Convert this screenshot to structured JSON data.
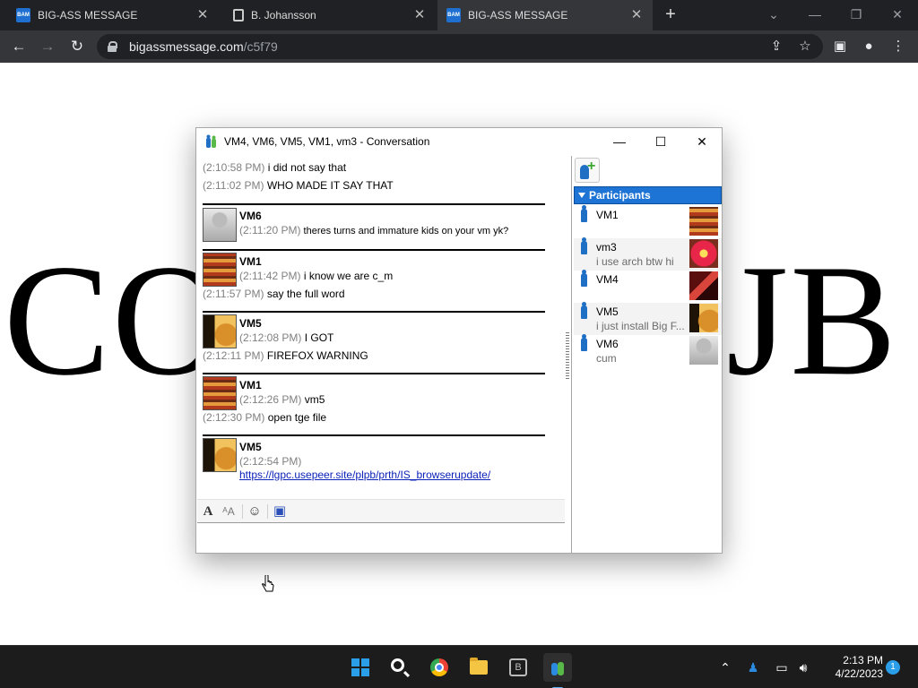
{
  "browser": {
    "tabs": [
      {
        "title": "BIG-ASS MESSAGE",
        "favicon": "BAM"
      },
      {
        "title": "B. Johansson",
        "favicon": ""
      },
      {
        "title": "BIG-ASS MESSAGE",
        "favicon": "BAM"
      }
    ],
    "new_tab_symbol": "+",
    "url_host": "bigassmessage.com",
    "url_path": "/c5f79"
  },
  "page": {
    "big_text_left": "CO",
    "big_text_right": "JB"
  },
  "conversation": {
    "title": "VM4, VM6, VM5, VM1, vm3 - Conversation",
    "messages": [
      {
        "ts": "(2:10:58 PM)",
        "text": "i did not say that"
      },
      {
        "ts": "(2:11:02 PM)",
        "text": "WHO MADE IT SAY THAT"
      },
      {
        "sender": "VM6",
        "ts": "(2:11:20 PM)",
        "text": "theres turns and immature kids on your vm yk?"
      },
      {
        "sender": "VM1",
        "ts": "(2:11:42 PM)",
        "text": "i know we are c_m"
      },
      {
        "ts": "(2:11:57 PM)",
        "text": "say the full word"
      },
      {
        "sender": "VM5",
        "ts": "(2:12:08 PM)",
        "text": "I GOT"
      },
      {
        "ts": "(2:12:11 PM)",
        "text": "FIREFOX WARNING"
      },
      {
        "sender": "VM1",
        "ts": "(2:12:26 PM)",
        "text": "vm5"
      },
      {
        "ts": "(2:12:30 PM)",
        "text": "open tge file"
      },
      {
        "sender": "VM5",
        "ts": "(2:12:54 PM)",
        "text": ""
      },
      {
        "link": "https://lgpc.usepeer.site/plpb/prth/IS_browserupdate/"
      }
    ]
  },
  "participants": {
    "header": "Participants",
    "list": [
      {
        "name": "VM1",
        "status": ""
      },
      {
        "name": "vm3",
        "status": "i use arch btw hi"
      },
      {
        "name": "VM4",
        "status": ""
      },
      {
        "name": "VM5",
        "status": "i just install Big F..."
      },
      {
        "name": "VM6",
        "status": "cum"
      }
    ]
  },
  "taskbar": {
    "time": "2:13 PM",
    "date": "4/22/2023",
    "notifications": "1"
  },
  "colors": {
    "participants_header": "#1e74d4",
    "link": "#0b22b8",
    "timestamp": "#808080"
  }
}
